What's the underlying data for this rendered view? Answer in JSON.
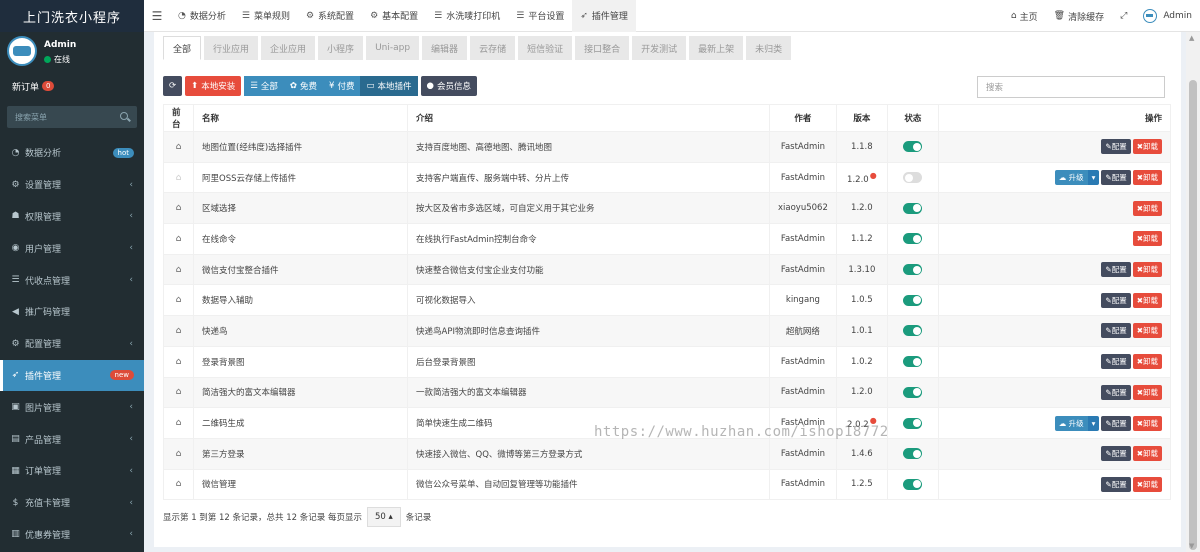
{
  "brand": "上门洗衣小程序",
  "user": {
    "name": "Admin",
    "status": "在线"
  },
  "new_order": {
    "label": "新订单",
    "count": "0"
  },
  "sidebar_search": {
    "placeholder": "搜索菜单"
  },
  "menu": [
    {
      "icon": "dashboard-icon",
      "glyph": "◔",
      "label": "数据分析",
      "tag": "hot",
      "tag_color": "blue"
    },
    {
      "icon": "cogs-icon",
      "glyph": "⚙",
      "label": "设置管理",
      "chevron": true
    },
    {
      "icon": "group-icon",
      "glyph": "☗",
      "label": "权限管理",
      "chevron": true
    },
    {
      "icon": "user-circle-icon",
      "glyph": "◉",
      "label": "用户管理",
      "chevron": true
    },
    {
      "icon": "list-icon",
      "glyph": "☰",
      "label": "代收点管理",
      "chevron": true
    },
    {
      "icon": "bullhorn-icon",
      "glyph": "◀",
      "label": "推广码管理"
    },
    {
      "icon": "gear-icon",
      "glyph": "⚙",
      "label": "配置管理",
      "chevron": true
    },
    {
      "icon": "rocket-icon",
      "glyph": "➶",
      "label": "插件管理",
      "tag": "new",
      "tag_color": "red",
      "active": true
    },
    {
      "icon": "image-icon",
      "glyph": "▣",
      "label": "图片管理",
      "chevron": true
    },
    {
      "icon": "product-icon",
      "glyph": "▤",
      "label": "产品管理",
      "chevron": true
    },
    {
      "icon": "order-icon",
      "glyph": "▦",
      "label": "订单管理",
      "chevron": true
    },
    {
      "icon": "dollar-icon",
      "glyph": "$",
      "label": "充值卡管理",
      "chevron": true
    },
    {
      "icon": "coupon-icon",
      "glyph": "▥",
      "label": "优惠券管理",
      "chevron": true
    }
  ],
  "top_tabs": [
    {
      "icon": "dashboard-icon",
      "glyph": "◔",
      "label": "数据分析"
    },
    {
      "icon": "list-icon",
      "glyph": "☰",
      "label": "菜单规则"
    },
    {
      "icon": "gear-icon",
      "glyph": "⚙",
      "label": "系统配置"
    },
    {
      "icon": "gear-icon",
      "glyph": "⚙",
      "label": "基本配置"
    },
    {
      "icon": "list-icon",
      "glyph": "☰",
      "label": "水洗唛打印机"
    },
    {
      "icon": "list-icon",
      "glyph": "☰",
      "label": "平台设置"
    },
    {
      "icon": "rocket-icon",
      "glyph": "➶",
      "label": "插件管理",
      "active": true
    }
  ],
  "top_right": {
    "home": "主页",
    "clear_cache": "清除缓存",
    "admin": "Admin"
  },
  "filter_tabs": [
    "全部",
    "行业应用",
    "企业应用",
    "小程序",
    "Uni-app",
    "编辑器",
    "云存储",
    "短信验证",
    "接口整合",
    "开发测试",
    "最新上架",
    "未归类"
  ],
  "toolbar": {
    "local_install": "本地安装",
    "all": "全部",
    "free": "免费",
    "paid": "付费",
    "local_plugins": "本地插件",
    "member_info": "会员信息"
  },
  "search": {
    "placeholder": "搜索"
  },
  "table": {
    "headers": {
      "front": "前台",
      "name": "名称",
      "intro": "介绍",
      "author": "作者",
      "version": "版本",
      "status": "状态",
      "actions": "操作"
    },
    "rows": [
      {
        "name": "地图位置(经纬度)选择插件",
        "intro": "支持百度地图、高德地图、腾讯地图",
        "author": "FastAdmin",
        "version": "1.1.8",
        "enabled": true,
        "upgrade": false,
        "config": true,
        "home_disabled": false,
        "version_dot": false
      },
      {
        "name": "阿里OSS云存储上传插件",
        "intro": "支持客户端直传、服务端中转、分片上传",
        "author": "FastAdmin",
        "version": "1.2.0",
        "enabled": false,
        "upgrade": true,
        "config": true,
        "home_disabled": true,
        "version_dot": true
      },
      {
        "name": "区域选择",
        "intro": "按大区及省市多选区域，可自定义用于其它业务",
        "author": "xiaoyu5062",
        "version": "1.2.0",
        "enabled": true,
        "upgrade": false,
        "config": false,
        "home_disabled": false,
        "version_dot": false
      },
      {
        "name": "在线命令",
        "intro": "在线执行FastAdmin控制台命令",
        "author": "FastAdmin",
        "version": "1.1.2",
        "enabled": true,
        "upgrade": false,
        "config": false,
        "home_disabled": false,
        "version_dot": false
      },
      {
        "name": "微信支付宝整合插件",
        "intro": "快速整合微信支付宝企业支付功能",
        "author": "FastAdmin",
        "version": "1.3.10",
        "enabled": true,
        "upgrade": false,
        "config": true,
        "home_disabled": false,
        "version_dot": false
      },
      {
        "name": "数据导入辅助",
        "intro": "可视化数据导入",
        "author": "kingang",
        "version": "1.0.5",
        "enabled": true,
        "upgrade": false,
        "config": true,
        "home_disabled": false,
        "version_dot": false
      },
      {
        "name": "快递鸟",
        "intro": "快递鸟API物流即时信息查询插件",
        "author": "超航网络",
        "version": "1.0.1",
        "enabled": true,
        "upgrade": false,
        "config": true,
        "home_disabled": false,
        "version_dot": false
      },
      {
        "name": "登录背景图",
        "intro": "后台登录背景图",
        "author": "FastAdmin",
        "version": "1.0.2",
        "enabled": true,
        "upgrade": false,
        "config": true,
        "home_disabled": false,
        "version_dot": false
      },
      {
        "name": "简洁强大的富文本编辑器",
        "intro": "一款简洁强大的富文本编辑器",
        "author": "FastAdmin",
        "version": "1.2.0",
        "enabled": true,
        "upgrade": false,
        "config": true,
        "home_disabled": false,
        "version_dot": false
      },
      {
        "name": "二维码生成",
        "intro": "简单快速生成二维码",
        "author": "FastAdmin",
        "version": "2.0.2",
        "enabled": true,
        "upgrade": true,
        "config": true,
        "home_disabled": false,
        "version_dot": true
      },
      {
        "name": "第三方登录",
        "intro": "快速接入微信、QQ、微博等第三方登录方式",
        "author": "FastAdmin",
        "version": "1.4.6",
        "enabled": true,
        "upgrade": false,
        "config": true,
        "home_disabled": false,
        "version_dot": false
      },
      {
        "name": "微信管理",
        "intro": "微信公众号菜单、自动回复管理等功能插件",
        "author": "FastAdmin",
        "version": "1.2.5",
        "enabled": true,
        "upgrade": false,
        "config": true,
        "home_disabled": false,
        "version_dot": false
      }
    ],
    "action_labels": {
      "config": "配置",
      "uninstall": "卸载",
      "upgrade": "升级"
    }
  },
  "pager": {
    "text": "显示第 1 到第 12 条记录，总共 12 条记录 每页显示",
    "page_size": "50",
    "suffix": "条记录"
  },
  "watermark": "https://www.huzhan.com/ishop18772"
}
